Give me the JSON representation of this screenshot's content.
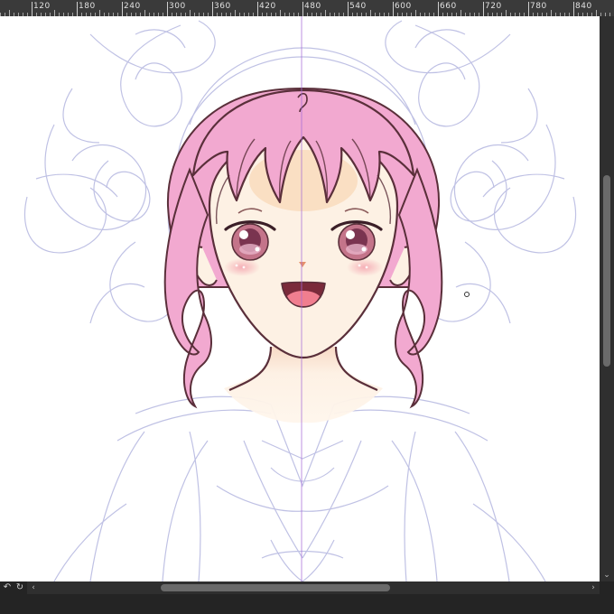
{
  "ruler": {
    "labels": [
      "120",
      "180",
      "240",
      "300",
      "360",
      "420",
      "480",
      "540",
      "600",
      "660",
      "720",
      "780",
      "840"
    ]
  },
  "scrollbars": {
    "left_arrow": "‹",
    "right_arrow": "›",
    "down_arrow": "⌄"
  },
  "bottom_icons": {
    "rotate_left": "↶",
    "rotate_right": "↻"
  },
  "colors": {
    "canvas": "#ffffff",
    "sketch_line": "#b9bbe2",
    "hair": "#f2a9d0",
    "skin": "#fdf1e4",
    "line_art": "#5a2f3a",
    "guide": "#a66cd8"
  }
}
